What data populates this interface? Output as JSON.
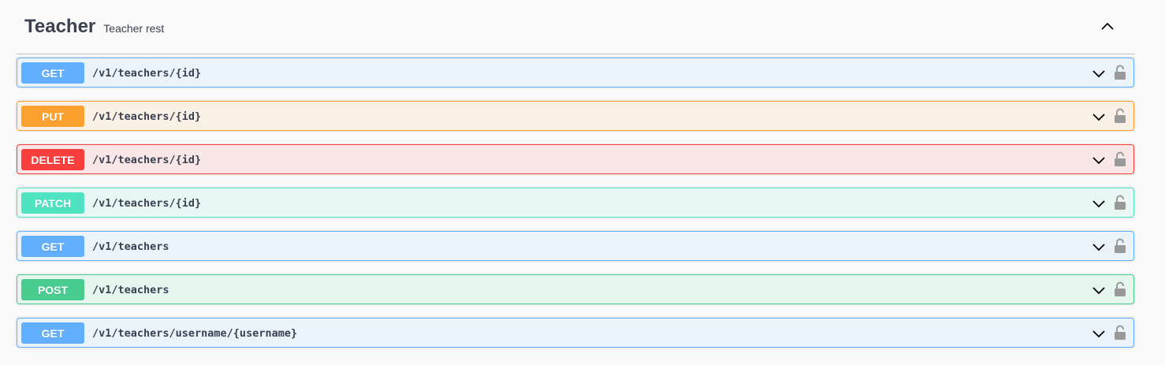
{
  "tag": {
    "name": "Teacher",
    "description": "Teacher rest",
    "toggle_icon": "chevron-up-icon"
  },
  "operations": [
    {
      "method": "GET",
      "path": "/v1/teachers/{id}",
      "expand_icon": "chevron-down-icon",
      "lock_icon": "unlocked-icon"
    },
    {
      "method": "PUT",
      "path": "/v1/teachers/{id}",
      "expand_icon": "chevron-down-icon",
      "lock_icon": "unlocked-icon"
    },
    {
      "method": "DELETE",
      "path": "/v1/teachers/{id}",
      "expand_icon": "chevron-down-icon",
      "lock_icon": "unlocked-icon"
    },
    {
      "method": "PATCH",
      "path": "/v1/teachers/{id}",
      "expand_icon": "chevron-down-icon",
      "lock_icon": "unlocked-icon"
    },
    {
      "method": "GET",
      "path": "/v1/teachers",
      "expand_icon": "chevron-down-icon",
      "lock_icon": "unlocked-icon"
    },
    {
      "method": "POST",
      "path": "/v1/teachers",
      "expand_icon": "chevron-down-icon",
      "lock_icon": "unlocked-icon"
    },
    {
      "method": "GET",
      "path": "/v1/teachers/username/{username}",
      "expand_icon": "chevron-down-icon",
      "lock_icon": "unlocked-icon"
    }
  ],
  "colors": {
    "get": "#61affe",
    "put": "#fca130",
    "delete": "#f93e3e",
    "patch": "#50e3c2",
    "post": "#49cc90"
  }
}
